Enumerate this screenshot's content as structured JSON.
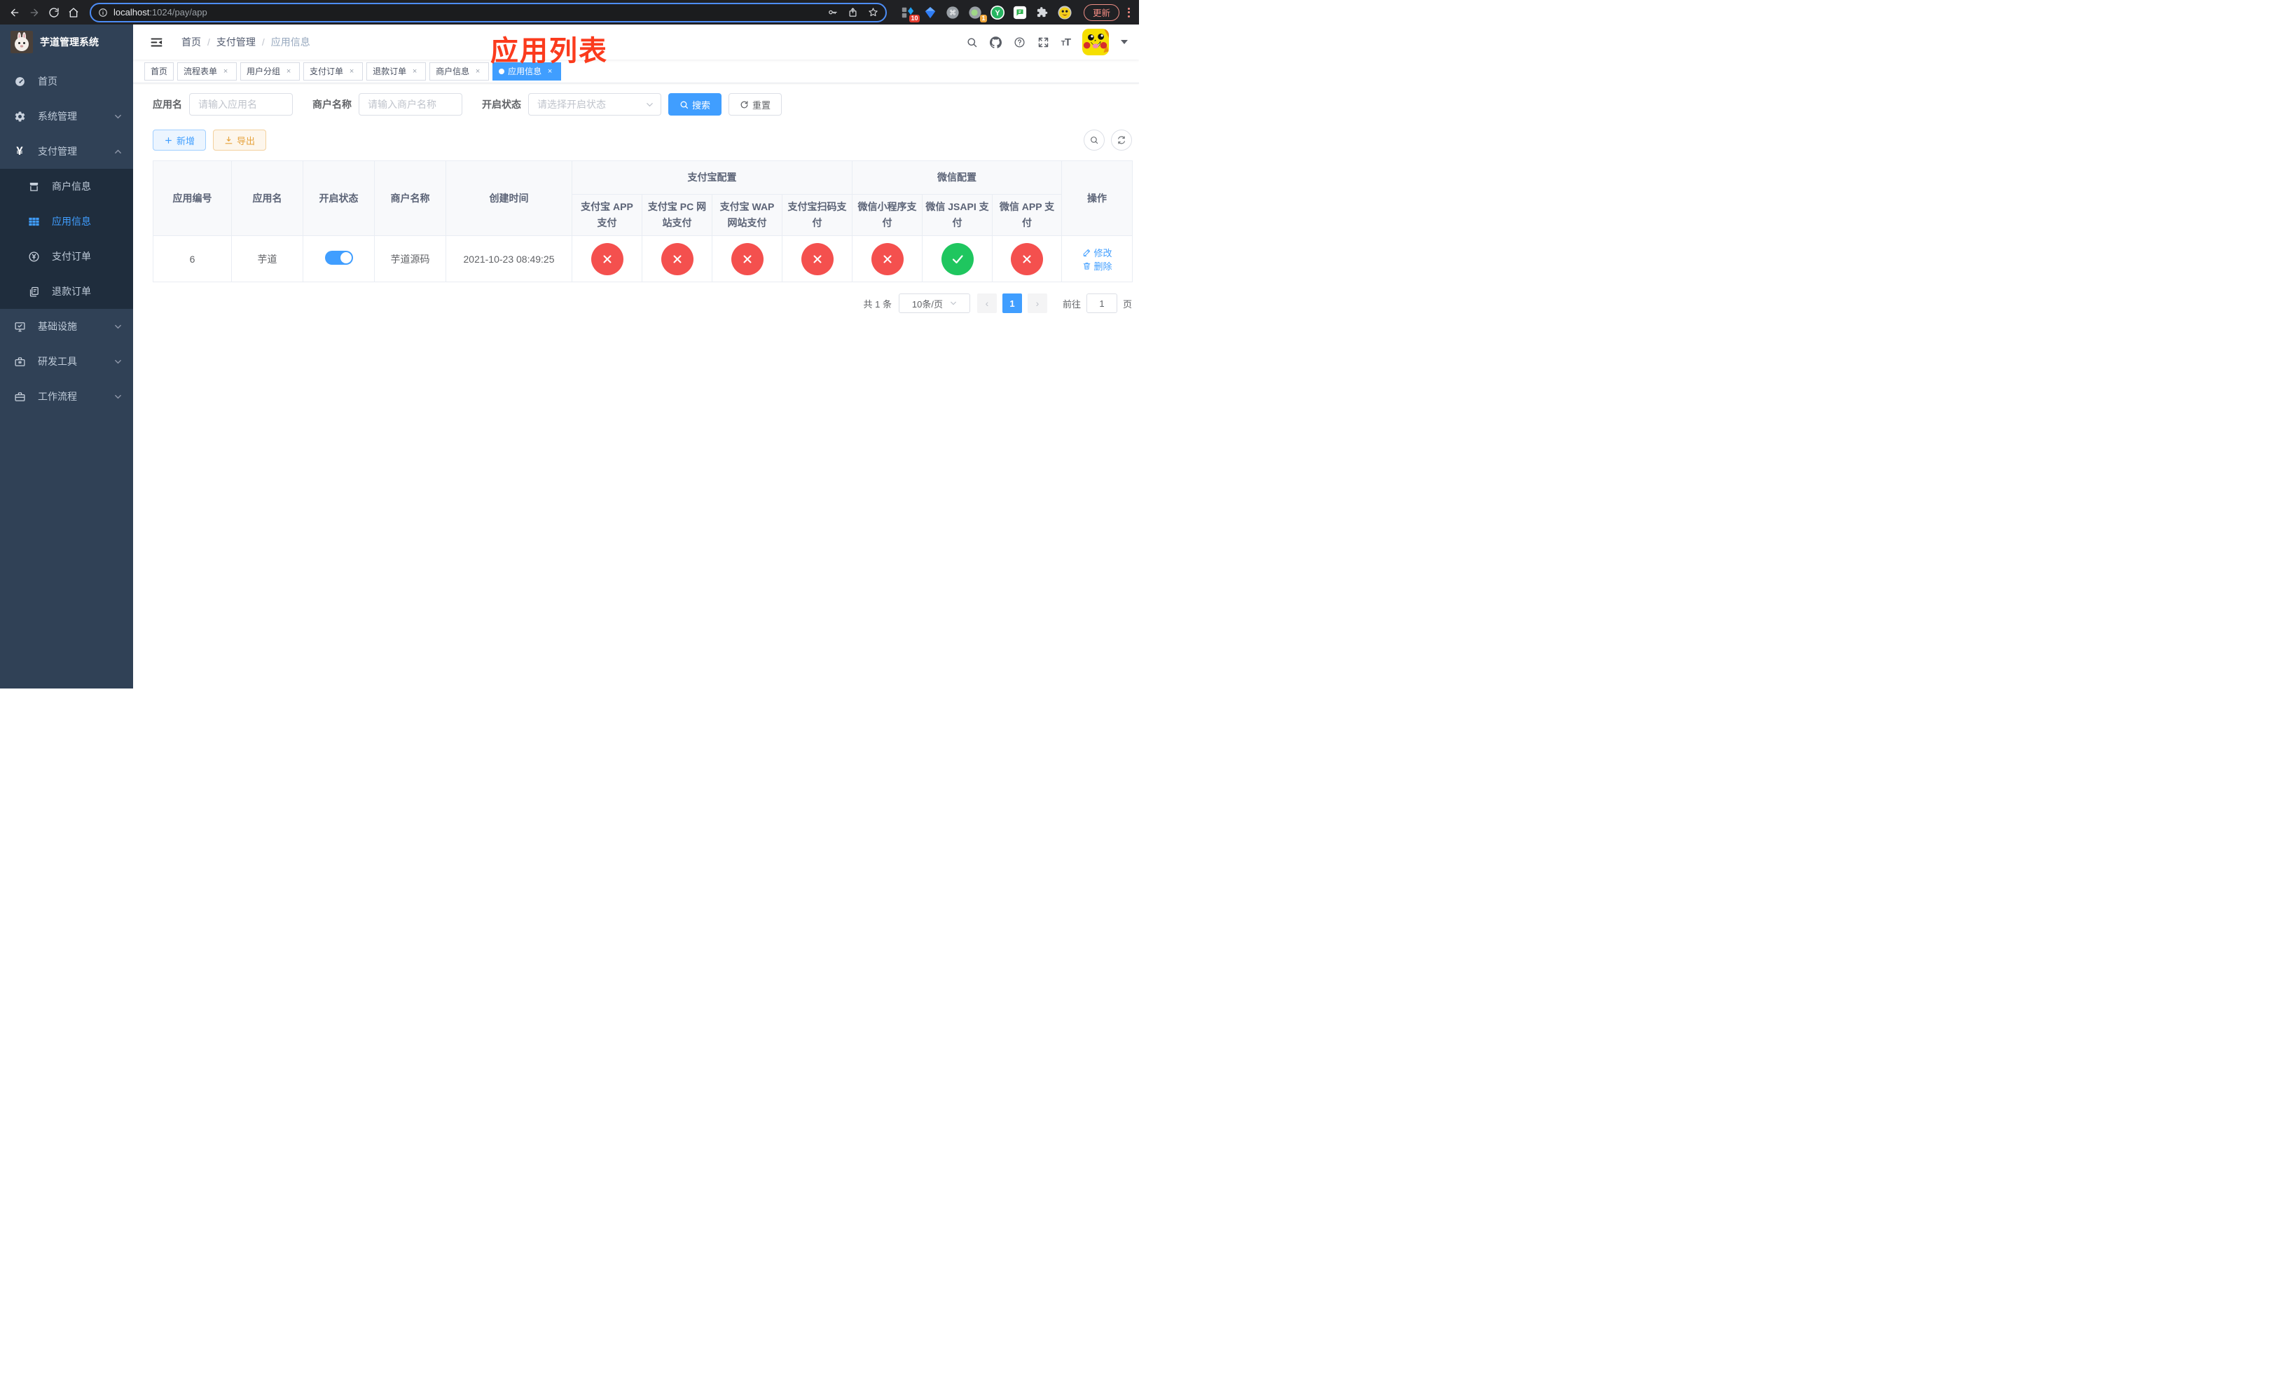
{
  "browser": {
    "url": {
      "host": "localhost",
      "rest": ":1024/pay/app"
    },
    "update_label": "更新",
    "extension_badges": {
      "first": "10",
      "second": "1"
    }
  },
  "annotation": {
    "title": "应用列表"
  },
  "sidebar": {
    "app_title": "芋道管理系统",
    "items": {
      "home": "首页",
      "system": "系统管理",
      "payment": "支付管理",
      "infra": "基础设施",
      "devtools": "研发工具",
      "workflow": "工作流程"
    },
    "payment_children": {
      "merchant": "商户信息",
      "app": "应用信息",
      "pay_order": "支付订单",
      "refund_order": "退款订单"
    }
  },
  "navbar": {
    "breadcrumb": [
      "首页",
      "支付管理",
      "应用信息"
    ]
  },
  "tabs": [
    {
      "label": "首页"
    },
    {
      "label": "流程表单"
    },
    {
      "label": "用户分组"
    },
    {
      "label": "支付订单"
    },
    {
      "label": "退款订单"
    },
    {
      "label": "商户信息"
    },
    {
      "label": "应用信息"
    }
  ],
  "filters": {
    "app_name": {
      "label": "应用名",
      "placeholder": "请输入应用名"
    },
    "merchant_name": {
      "label": "商户名称",
      "placeholder": "请输入商户名称"
    },
    "status": {
      "label": "开启状态",
      "placeholder": "请选择开启状态"
    },
    "search": "搜索",
    "reset": "重置"
  },
  "actions": {
    "add": "新增",
    "export": "导出"
  },
  "table": {
    "groups": {
      "alipay": "支付宝配置",
      "wechat": "微信配置"
    },
    "headers": {
      "id": "应用编号",
      "name": "应用名",
      "status": "开启状态",
      "merchant": "商户名称",
      "created": "创建时间",
      "alipay_app": "支付宝 APP 支付",
      "alipay_pc": "支付宝 PC 网站支付",
      "alipay_wap": "支付宝 WAP 网站支付",
      "alipay_qr": "支付宝扫码支付",
      "wx_mini": "微信小程序支付",
      "wx_jsapi": "微信 JSAPI 支付",
      "wx_app": "微信 APP 支付",
      "ops": "操作"
    },
    "rows": [
      {
        "id": "6",
        "name": "芋道",
        "enabled": true,
        "merchant": "芋道源码",
        "created": "2021-10-23 08:49:25",
        "channels": [
          "fail",
          "fail",
          "fail",
          "fail",
          "fail",
          "ok",
          "fail"
        ],
        "edit": "修改",
        "remove": "删除"
      }
    ]
  },
  "pagination": {
    "total": "共 1 条",
    "size": "10条/页",
    "current": "1",
    "goto": "前往",
    "goto_value": "1",
    "page_unit": "页"
  },
  "colors": {
    "accent": "#409eff",
    "success": "#1fc65f",
    "danger": "#f4504e",
    "warning": "#e6a23c",
    "sidebar_bg": "#304156",
    "sidebar_submenu_bg": "#1f2d3d",
    "annotation": "#fb3b1d"
  }
}
